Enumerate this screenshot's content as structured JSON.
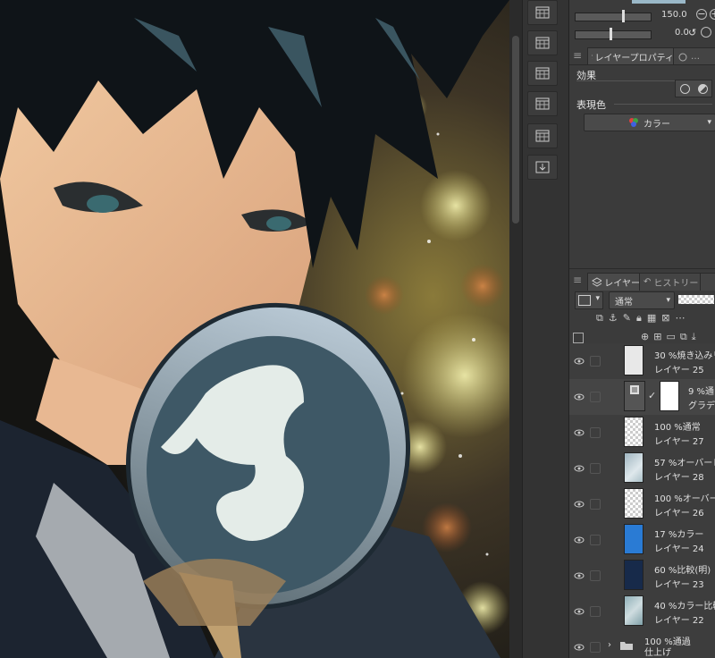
{
  "canvas": {
    "description_alt": ""
  },
  "properties": {
    "slider1_value": "150.0",
    "slider2_value": "0.0",
    "tab_layer_property": "レイヤープロパティ",
    "effect_label": "効果",
    "expression_color_label": "表現色",
    "expression_color_value": "カラー"
  },
  "layers_panel": {
    "tab_layer": "レイヤー",
    "tab_history": "ヒストリー",
    "blend_mode": "通常",
    "layers": [
      {
        "line1": "30 %焼き込みリ",
        "line2": "レイヤー 25",
        "thumb": "light"
      },
      {
        "line1": "9 %通",
        "line2": "グラデー",
        "thumb": "mask"
      },
      {
        "line1": "100 %通常",
        "line2": "レイヤー 27",
        "thumb": "checker"
      },
      {
        "line1": "57 %オーバーレ",
        "line2": "レイヤー 28",
        "thumb": "bluegray"
      },
      {
        "line1": "100 %オーバー",
        "line2": "レイヤー 26",
        "thumb": "checker"
      },
      {
        "line1": "17 %カラー",
        "line2": "レイヤー 24",
        "thumb": "blue"
      },
      {
        "line1": "60 %比較(明)",
        "line2": "レイヤー 23",
        "thumb": "navy"
      },
      {
        "line1": "40 %カラー比較",
        "line2": "レイヤー 22",
        "thumb": "teal"
      }
    ],
    "folder": {
      "line1": "100 %通過",
      "line2": "仕上げ"
    }
  },
  "colors": {
    "panel_bg": "#3b3b3b",
    "accent_blue": "#2a7bd4"
  }
}
